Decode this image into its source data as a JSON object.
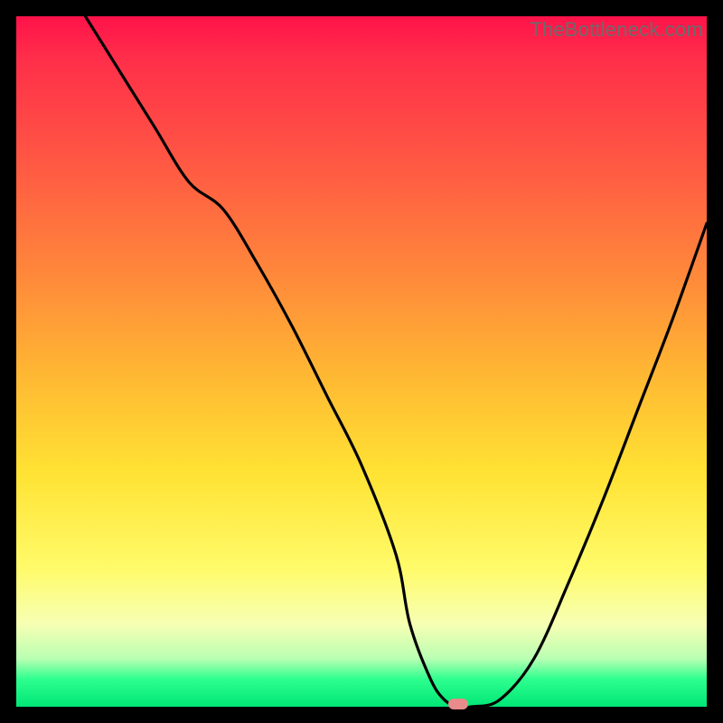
{
  "watermark": "TheBottleneck.com",
  "colors": {
    "frame": "#000000",
    "gradient_top": "#ff124a",
    "gradient_bottom": "#00e676",
    "curve": "#000000",
    "marker": "#e78b8b"
  },
  "chart_data": {
    "type": "line",
    "title": "",
    "xlabel": "",
    "ylabel": "",
    "xlim": [
      0,
      100
    ],
    "ylim": [
      0,
      100
    ],
    "grid": false,
    "legend": false,
    "series": [
      {
        "name": "bottleneck-curve",
        "x": [
          10,
          15,
          20,
          25,
          30,
          35,
          40,
          45,
          50,
          55,
          57,
          60,
          62,
          64,
          66,
          70,
          75,
          80,
          85,
          90,
          95,
          100
        ],
        "values": [
          100,
          92,
          84,
          76,
          72,
          64,
          55,
          45,
          35,
          22,
          12,
          4,
          1,
          0,
          0,
          1,
          7,
          18,
          30,
          43,
          56,
          70
        ]
      }
    ],
    "marker": {
      "x": 64,
      "y": 0
    }
  }
}
